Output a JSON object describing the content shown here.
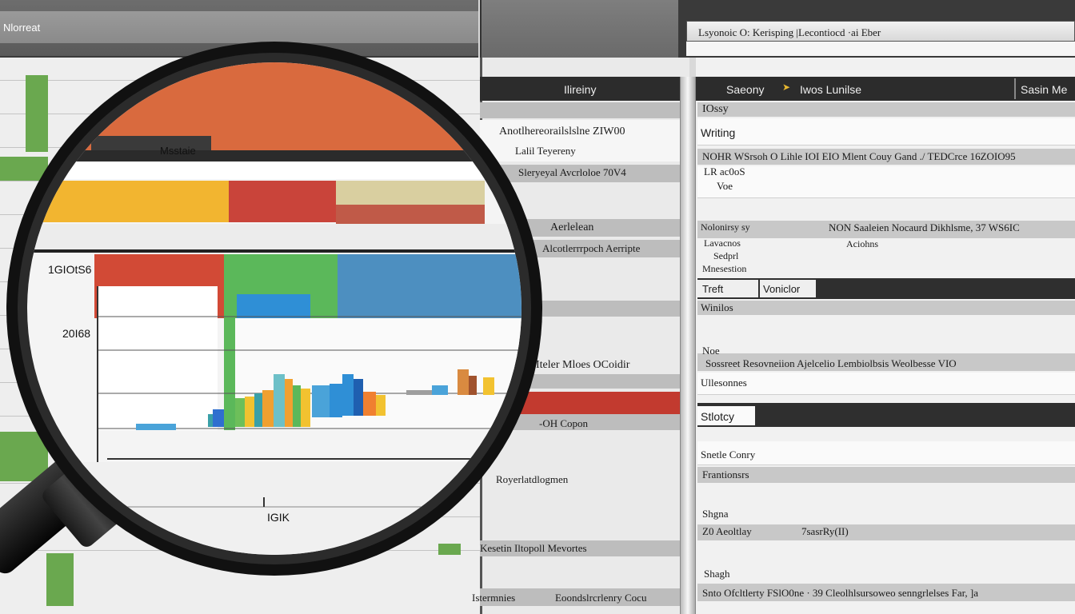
{
  "window": {
    "top_left_label": "Nlorreat"
  },
  "search": {
    "text": "Lsyonoic O: Kerisping |Lecontiocd  ·ai  Eber"
  },
  "mid_panel": {
    "header": "Ilireiny",
    "rows": [
      "Anotlhereorailslslne  ZIW00",
      "Lalil Teyereny",
      "Sleryeyal Avcrloloe 70V4",
      "Aerlelean",
      "Alcotlerrrpoch Aerripte",
      "Iteler Mloes OCoidir",
      "-OH Copon",
      "Royerlatdlogmen",
      "Kesetin Iltopoll Mevortes",
      "Istermnies",
      "Eoondslrcrlenry Cocu"
    ]
  },
  "right_panel": {
    "header_left": "Saeony",
    "header_mid": "Iwos Lunilse",
    "header_right": "Sasin Me",
    "rows": [
      "IOssy",
      "Writing",
      "NOHR WSrsoh O Lihle  IOI EIO Mlent Couy Gand  ./ TEDCrce  16ZOIO95",
      "LR ac0oS",
      "Voe",
      "Nolonirsy sy",
      "NON Saaleien Nocaurd Dikhlsme,  37 WS6IC",
      "Lavacnos",
      "Sedprl",
      "Mnesestion",
      "Aciohns",
      "Treft",
      "Voniclor",
      "Winilos",
      "Noe",
      "Sossreet Resovneiion Ajelcelio Lembiolbsis Weolbesse  VIO",
      "Ullesonnes",
      "Stlotcy",
      "Snetle Conry",
      "Frantionsrs",
      "Shgna",
      "Z0 Aeoltlay",
      "7sasrRy(II)",
      "Shagh",
      "Snto Ofcltlerty FSlO0ne  · 39 Cleolhlsursoweo senngrlelses  Far,  ]a"
    ]
  },
  "chart": {
    "header_label": "Msstaie",
    "y_ticks": [
      "1GIOtS6",
      "20I68"
    ],
    "x_tick": "IGIK",
    "colors": {
      "red": "#d94a38",
      "green": "#5cb85c",
      "blue": "#4a90c2",
      "orange": "#f0a030",
      "yellow": "#f2c230",
      "teal": "#3aa0a8",
      "purple": "#8e6bbf"
    }
  }
}
